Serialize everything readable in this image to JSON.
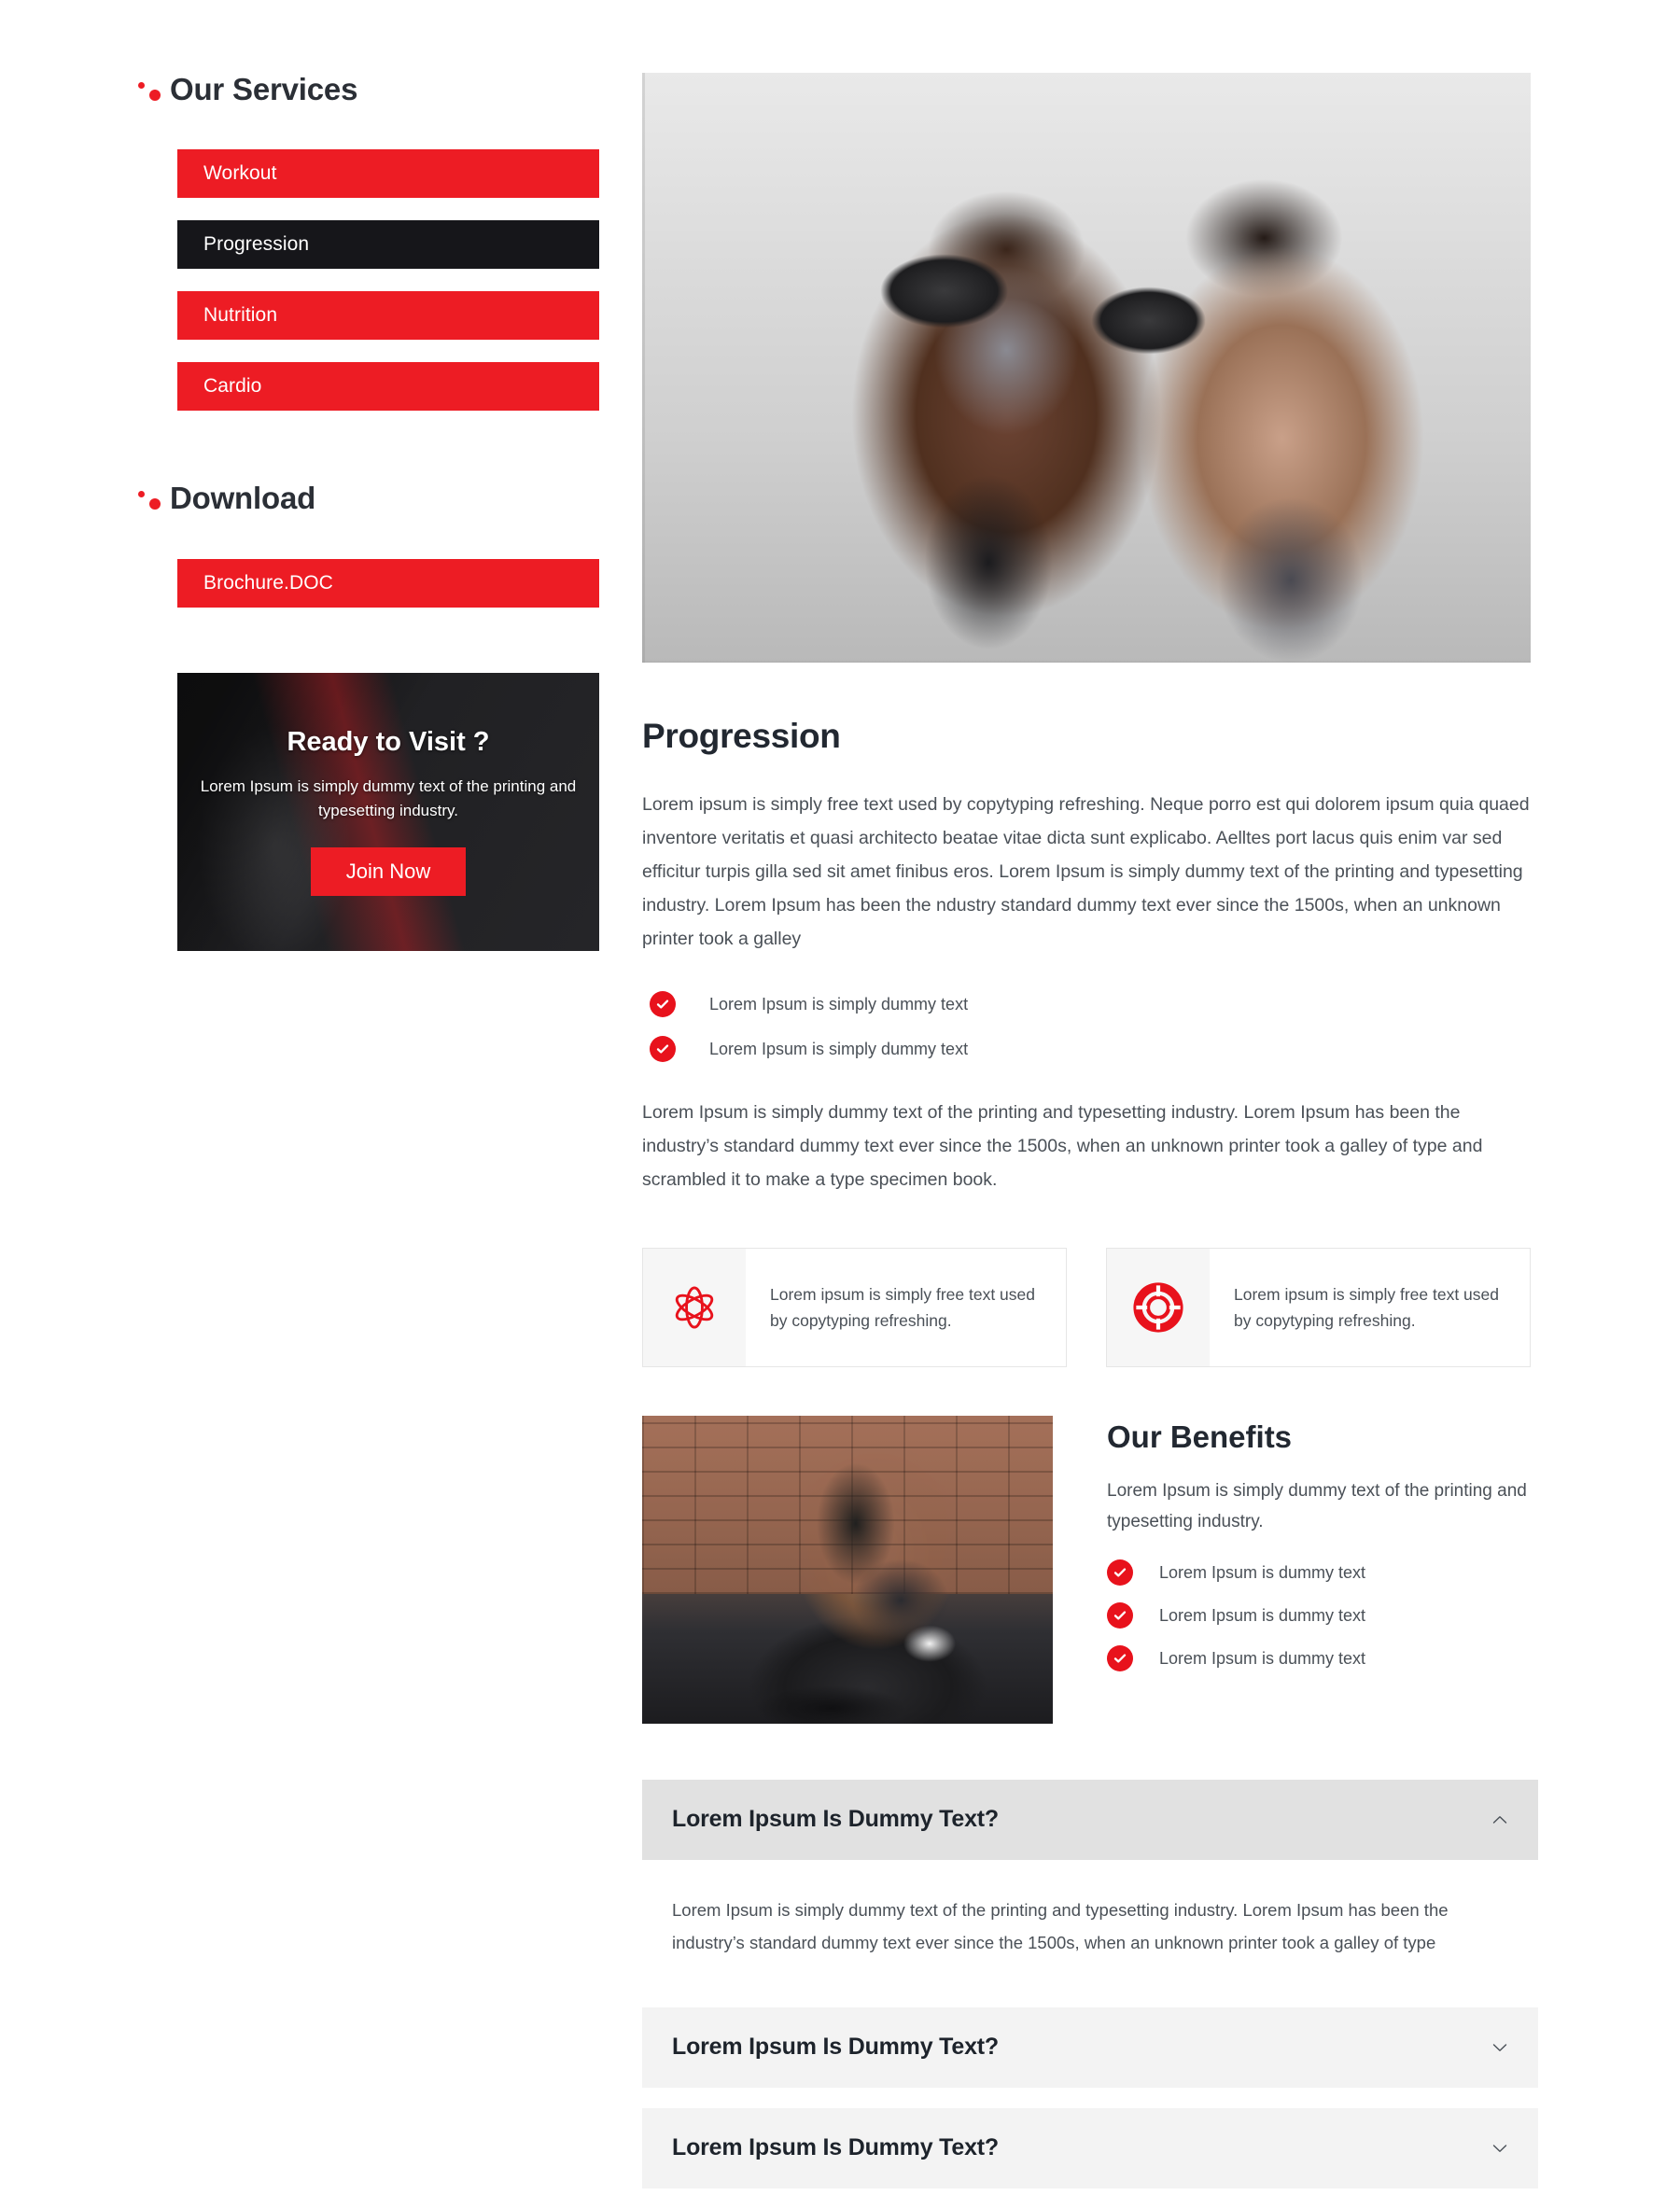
{
  "sidebar": {
    "services": {
      "title": "Our Services",
      "items": [
        {
          "label": "Workout",
          "active": false
        },
        {
          "label": "Progression",
          "active": true
        },
        {
          "label": "Nutrition",
          "active": false
        },
        {
          "label": "Cardio",
          "active": false
        }
      ]
    },
    "download": {
      "title": "Download",
      "items": [
        {
          "label": "Brochure.DOC"
        }
      ]
    },
    "promo": {
      "title": "Ready to Visit ?",
      "text": "Lorem Ipsum is simply dummy text of the printing and typesetting industry.",
      "button_label": "Join Now"
    }
  },
  "main": {
    "hero_image_alt": "woman lifting dumbbells with trainer in gym",
    "section_title": "Progression",
    "paragraph_1": "Lorem ipsum is simply free text used by copytyping refreshing. Neque porro est qui dolorem ipsum quia quaed inventore veritatis et quasi architecto beatae vitae dicta sunt explicabo. Aelltes port lacus quis enim var sed efficitur turpis gilla sed sit amet finibus eros. Lorem Ipsum is simply dummy text of the printing and typesetting industry. Lorem Ipsum has been the ndustry standard dummy text ever since the 1500s, when an unknown printer took a galley",
    "check_items": [
      "Lorem Ipsum is simply dummy text",
      "Lorem Ipsum is simply dummy text"
    ],
    "paragraph_2": "Lorem Ipsum is simply dummy text of the printing and typesetting industry. Lorem Ipsum has been the industry’s standard dummy text ever since the 1500s, when an unknown printer took a galley of type and scrambled it to make a type specimen book.",
    "features": [
      {
        "icon": "atom-icon",
        "text": "Lorem ipsum is simply free text used by copytyping refreshing."
      },
      {
        "icon": "lifebuoy-icon",
        "text": "Lorem ipsum is simply free text used by copytyping refreshing."
      }
    ],
    "benefits": {
      "image_alt": "woman doing step ups on tire in gym",
      "title": "Our Benefits",
      "description": "Lorem Ipsum is simply dummy text of the printing and typesetting industry.",
      "items": [
        "Lorem Ipsum is dummy text",
        "Lorem Ipsum is dummy text",
        "Lorem Ipsum is dummy text"
      ]
    },
    "accordion": [
      {
        "title": "Lorem Ipsum Is Dummy Text?",
        "open": true,
        "chevron": "chevron-up",
        "body": "Lorem Ipsum is simply dummy text of the printing and typesetting industry. Lorem Ipsum has been the industry’s standard dummy text ever since the 1500s, when an unknown printer took a galley of type"
      },
      {
        "title": "Lorem Ipsum Is Dummy Text?",
        "open": false,
        "chevron": "chevron-down",
        "body": ""
      },
      {
        "title": "Lorem Ipsum Is Dummy Text?",
        "open": false,
        "chevron": "chevron-down",
        "body": ""
      }
    ]
  },
  "colors": {
    "accent_red": "#ed1c24",
    "active_dark": "#16161a",
    "heading": "#222831",
    "body_text": "#4a5057",
    "accordion_open_bg": "#e1e1e1",
    "accordion_closed_bg": "#f3f3f3"
  }
}
